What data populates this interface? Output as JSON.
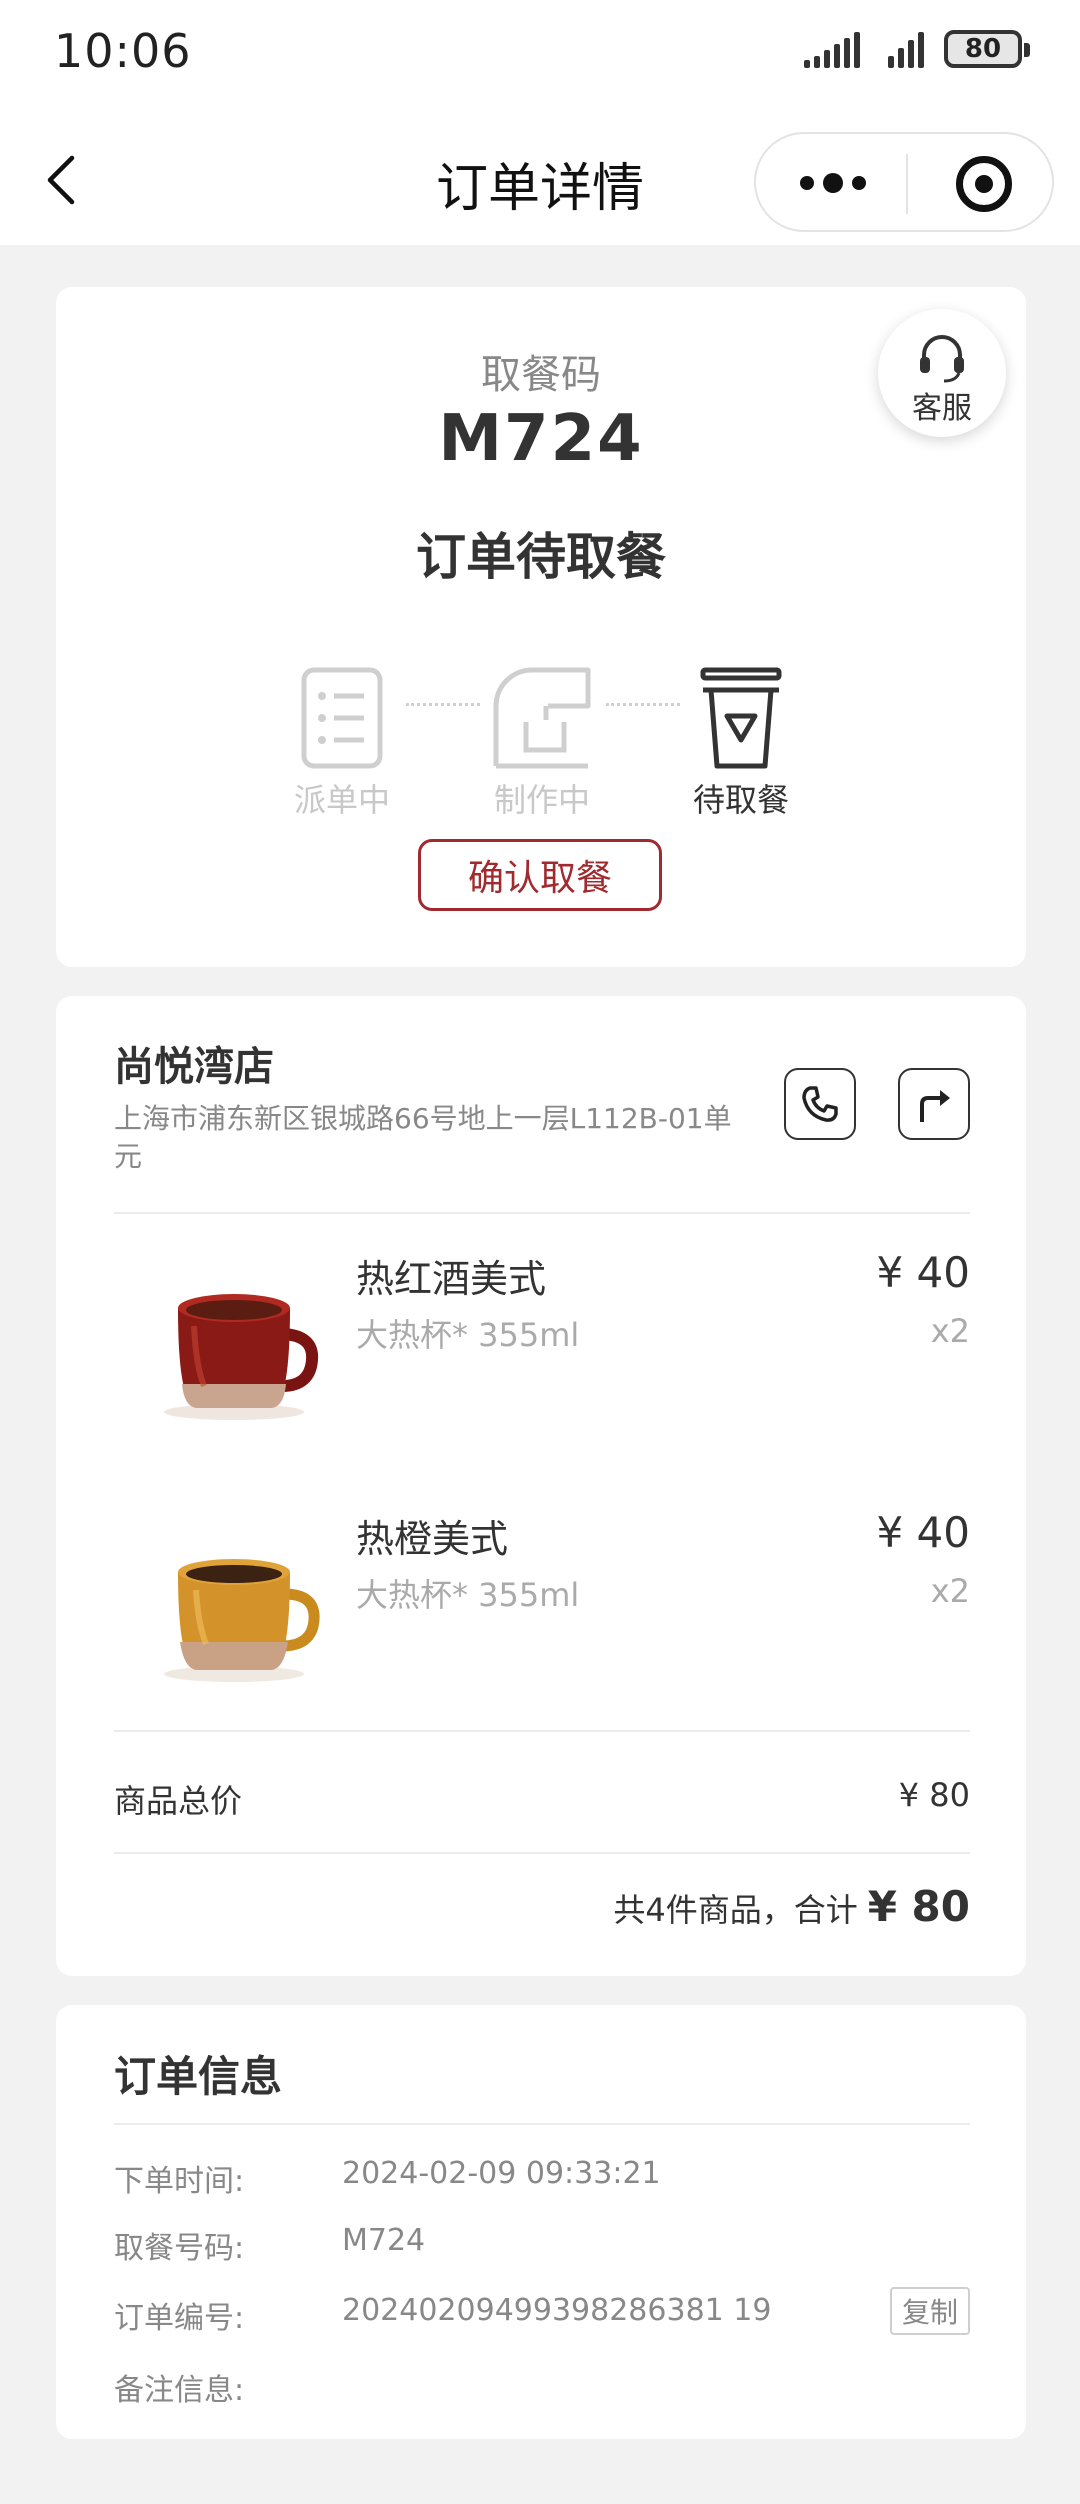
{
  "status_bar": {
    "time": "10:06",
    "battery": "80"
  },
  "nav": {
    "title": "订单详情"
  },
  "pickup": {
    "label": "取餐码",
    "code": "M724",
    "status_title": "订单待取餐",
    "service_label": "客服",
    "steps": [
      {
        "label": "派单中",
        "active": false
      },
      {
        "label": "制作中",
        "active": false
      },
      {
        "label": "待取餐",
        "active": true
      }
    ],
    "confirm_label": "确认取餐",
    "accent_color": "#a12a2f"
  },
  "store": {
    "name": "尚悦湾店",
    "address": "上海市浦东新区银城路66号地上一层L112B-01单元"
  },
  "items": [
    {
      "name": "热红酒美式",
      "spec": "大热杯* 355ml",
      "price": "¥ 40",
      "qty": "x2"
    },
    {
      "name": "热橙美式",
      "spec": "大热杯* 355ml",
      "price": "¥ 40",
      "qty": "x2"
    }
  ],
  "totals": {
    "goods_label": "商品总价",
    "goods_value": "¥ 80",
    "summary_text": "共4件商品，合计",
    "summary_value": "¥ 80"
  },
  "order_info": {
    "title": "订单信息",
    "rows": [
      {
        "key": "下单时间:",
        "value": "2024-02-09 09:33:21"
      },
      {
        "key": "取餐号码:",
        "value": "M724"
      },
      {
        "key": "订单编号:",
        "value": "20240209499398286381 19"
      },
      {
        "key": "备注信息:",
        "value": ""
      }
    ],
    "copy_label": "复制"
  }
}
